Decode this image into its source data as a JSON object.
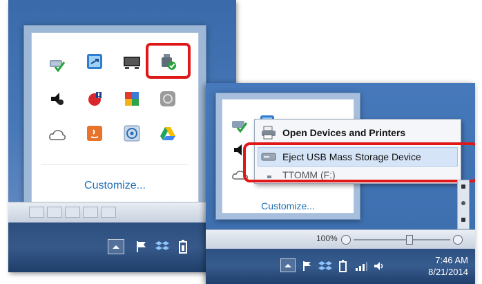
{
  "left_panel": {
    "customize_label": "Customize...",
    "icons": [
      "network-check-icon",
      "terminal-services-icon",
      "display-icon",
      "usb-safe-remove-icon",
      "speaker-shield-icon",
      "alert-shield-icon",
      "avg-antivirus-icon",
      "sync-icon",
      "onedrive-cloud-icon",
      "java-update-icon",
      "disc-icon",
      "google-drive-icon"
    ]
  },
  "right_panel": {
    "customize_label": "Customize...",
    "context_menu": {
      "items": [
        {
          "label": "Open Devices and Printers",
          "icon": "printer-icon"
        },
        {
          "label": "Eject USB Mass Storage Device",
          "icon": "usb-drive-icon"
        },
        {
          "label": "TTOMM (F:)",
          "icon": "drive-icon"
        }
      ]
    },
    "clock": {
      "time": "7:46 AM",
      "date": "8/21/2014"
    },
    "strip_value": "100%"
  },
  "colors": {
    "highlight": "#e01818",
    "link": "#1f6fb5"
  }
}
